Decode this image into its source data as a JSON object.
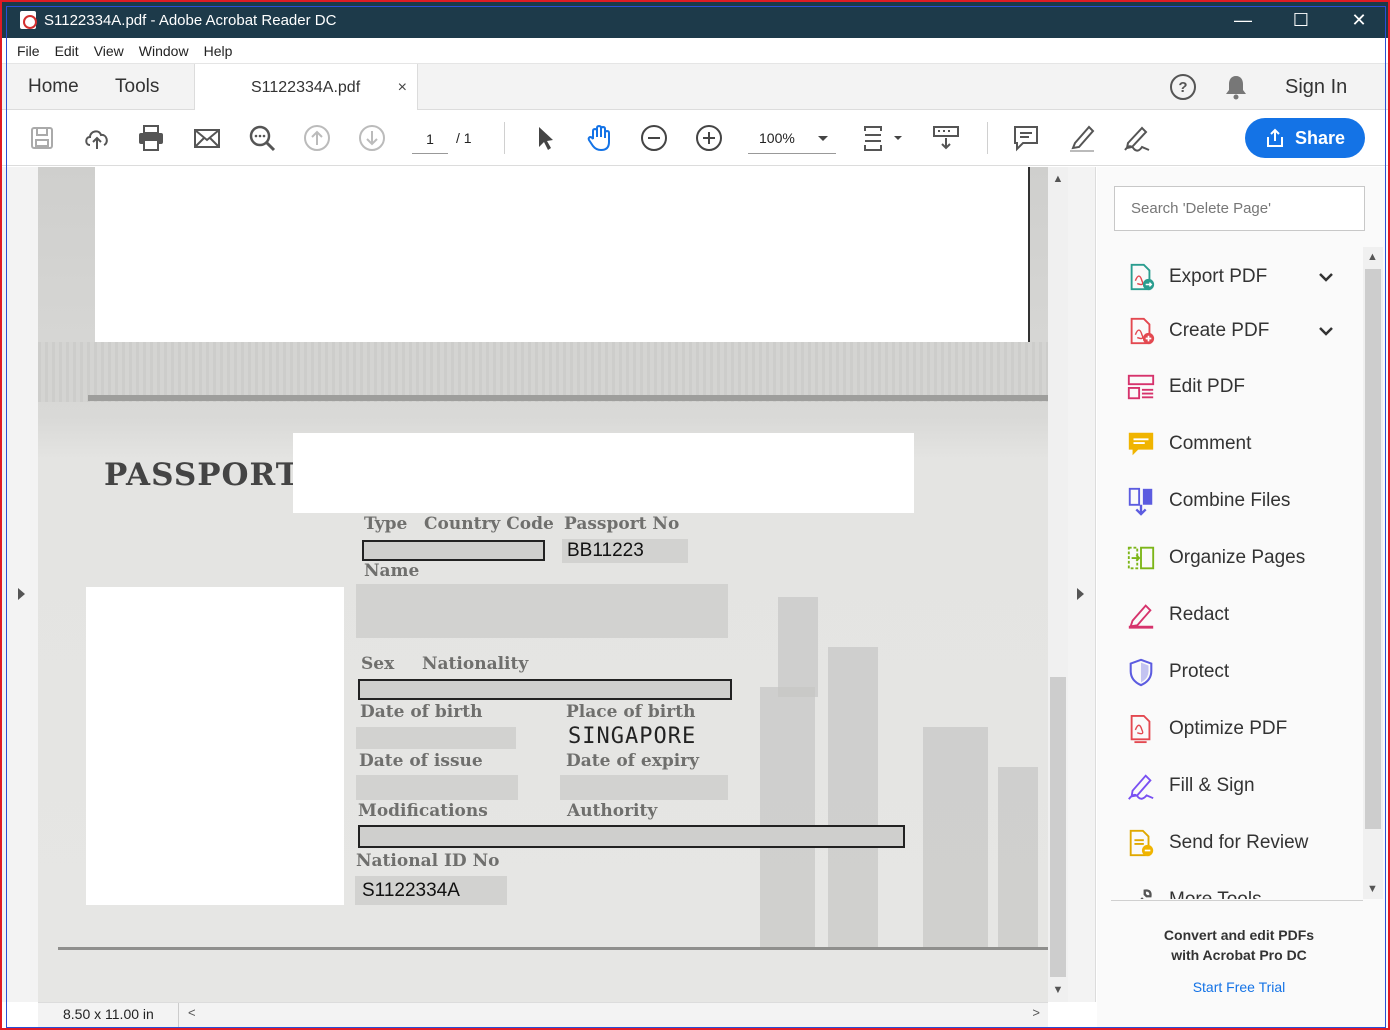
{
  "window": {
    "title": "S1122334A.pdf - Adobe Acrobat Reader DC",
    "minimize": "—",
    "maximize": "☐",
    "close": "✕"
  },
  "menu": [
    "File",
    "Edit",
    "View",
    "Window",
    "Help"
  ],
  "tabs": {
    "home": "Home",
    "tools": "Tools",
    "document": "S1122334A.pdf",
    "document_close": "×"
  },
  "header": {
    "help": "?",
    "sign_in": "Sign In"
  },
  "toolbar": {
    "page_current": "1",
    "page_total": "/ 1",
    "zoom": "100%",
    "share_label": "Share"
  },
  "document": {
    "heading": "PASSPORT",
    "labels": {
      "type": "Type",
      "country_code": "Country Code",
      "passport_no": "Passport No",
      "name": "Name",
      "sex": "Sex",
      "nationality": "Nationality",
      "date_of_birth": "Date of birth",
      "place_of_birth": "Place of birth",
      "date_of_issue": "Date of issue",
      "date_of_expiry": "Date of expiry",
      "modifications": "Modifications",
      "authority": "Authority",
      "national_id_no": "National ID No"
    },
    "values": {
      "passport_no": "BB11223",
      "place_of_birth": "SINGAPORE",
      "national_id_no": "S1122334A"
    }
  },
  "status": {
    "page_size": "8.50 x 11.00 in"
  },
  "right_panel": {
    "search_placeholder": "Search 'Delete Page'",
    "tools": [
      {
        "label": "Export PDF",
        "icon": "export-pdf-icon",
        "expandable": true
      },
      {
        "label": "Create PDF",
        "icon": "create-pdf-icon",
        "expandable": true
      },
      {
        "label": "Edit PDF",
        "icon": "edit-pdf-icon",
        "expandable": false
      },
      {
        "label": "Comment",
        "icon": "comment-icon",
        "expandable": false
      },
      {
        "label": "Combine Files",
        "icon": "combine-files-icon",
        "expandable": false
      },
      {
        "label": "Organize Pages",
        "icon": "organize-pages-icon",
        "expandable": false
      },
      {
        "label": "Redact",
        "icon": "redact-icon",
        "expandable": false
      },
      {
        "label": "Protect",
        "icon": "protect-icon",
        "expandable": false
      },
      {
        "label": "Optimize PDF",
        "icon": "optimize-pdf-icon",
        "expandable": false
      },
      {
        "label": "Fill & Sign",
        "icon": "fill-sign-icon",
        "expandable": false
      },
      {
        "label": "Send for Review",
        "icon": "send-for-review-icon",
        "expandable": false
      },
      {
        "label": "More Tools",
        "icon": "more-tools-icon",
        "expandable": false
      }
    ],
    "promo_line1": "Convert and edit PDFs",
    "promo_line2": "with Acrobat Pro DC",
    "trial_link": "Start Free Trial"
  },
  "colors": {
    "titlebar": "#1d3a4a",
    "accent": "#1473e6"
  }
}
